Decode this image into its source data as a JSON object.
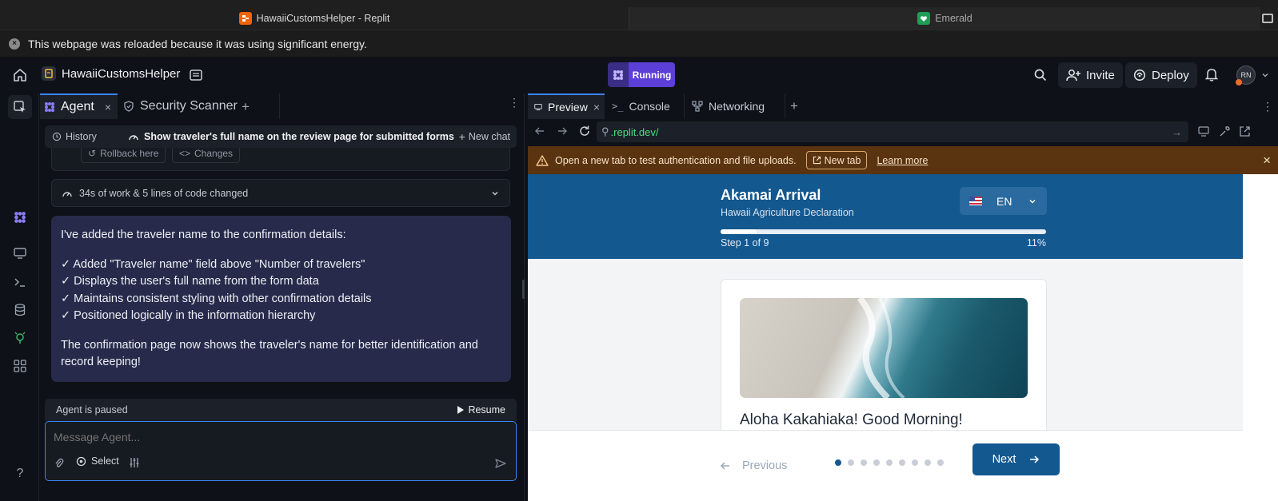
{
  "browser": {
    "tabs": [
      {
        "title": "HawaiiCustomsHelper - Replit",
        "active": true
      },
      {
        "title": "Emerald",
        "active": false
      }
    ],
    "reload_notice": "This webpage was reloaded because it was using significant energy."
  },
  "header": {
    "project_name": "HawaiiCustomsHelper",
    "run_status": "Running",
    "invite_label": "Invite",
    "deploy_label": "Deploy",
    "avatar_initials": "RN"
  },
  "agent_panel": {
    "tabs": [
      {
        "label": "Agent"
      },
      {
        "label": "Security Scanner"
      }
    ],
    "history_label": "History",
    "chat_title": "Show traveler's full name on the review page for submitted forms",
    "new_chat_label": "New chat",
    "checkpoint_actions": [
      "Rollback here",
      "Changes"
    ],
    "work_summary": "34s of work & 5 lines of code changed",
    "message": {
      "intro": "I've added the traveler name to the confirmation details:",
      "bullets": [
        "✓ Added \"Traveler name\" field above \"Number of travelers\"",
        "✓ Displays the user's full name from the form data",
        "✓ Maintains consistent styling with other confirmation details",
        "✓ Positioned logically in the information hierarchy"
      ],
      "outro": "The confirmation page now shows the traveler's name for better identification and record keeping!"
    },
    "paused_label": "Agent is paused",
    "resume_label": "Resume",
    "composer_placeholder": "Message Agent...",
    "select_label": "Select"
  },
  "right_pane": {
    "tabs": [
      {
        "label": "Preview"
      },
      {
        "label": "Console"
      },
      {
        "label": "Networking"
      }
    ],
    "url": ".replit.dev/",
    "warning": {
      "text": "Open a new tab to test authentication and file uploads.",
      "new_tab_label": "New tab",
      "learn_more_label": "Learn more"
    }
  },
  "site": {
    "title": "Akamai Arrival",
    "subtitle": "Hawaii Agriculture Declaration",
    "language": "EN",
    "step_text": "Step 1 of 9",
    "progress_percent_label": "11%",
    "progress_value": 0.11,
    "greeting": "Aloha Kakahiaka! Good Morning!",
    "previous_label": "Previous",
    "next_label": "Next",
    "step_count": 9,
    "current_step": 1
  },
  "colors": {
    "accent_blue": "#3b82f6",
    "running_purple": "#5b3fd6",
    "site_blue": "#13588f",
    "warning_bg": "#5a3410",
    "agent_message_bg": "#272a4a"
  }
}
